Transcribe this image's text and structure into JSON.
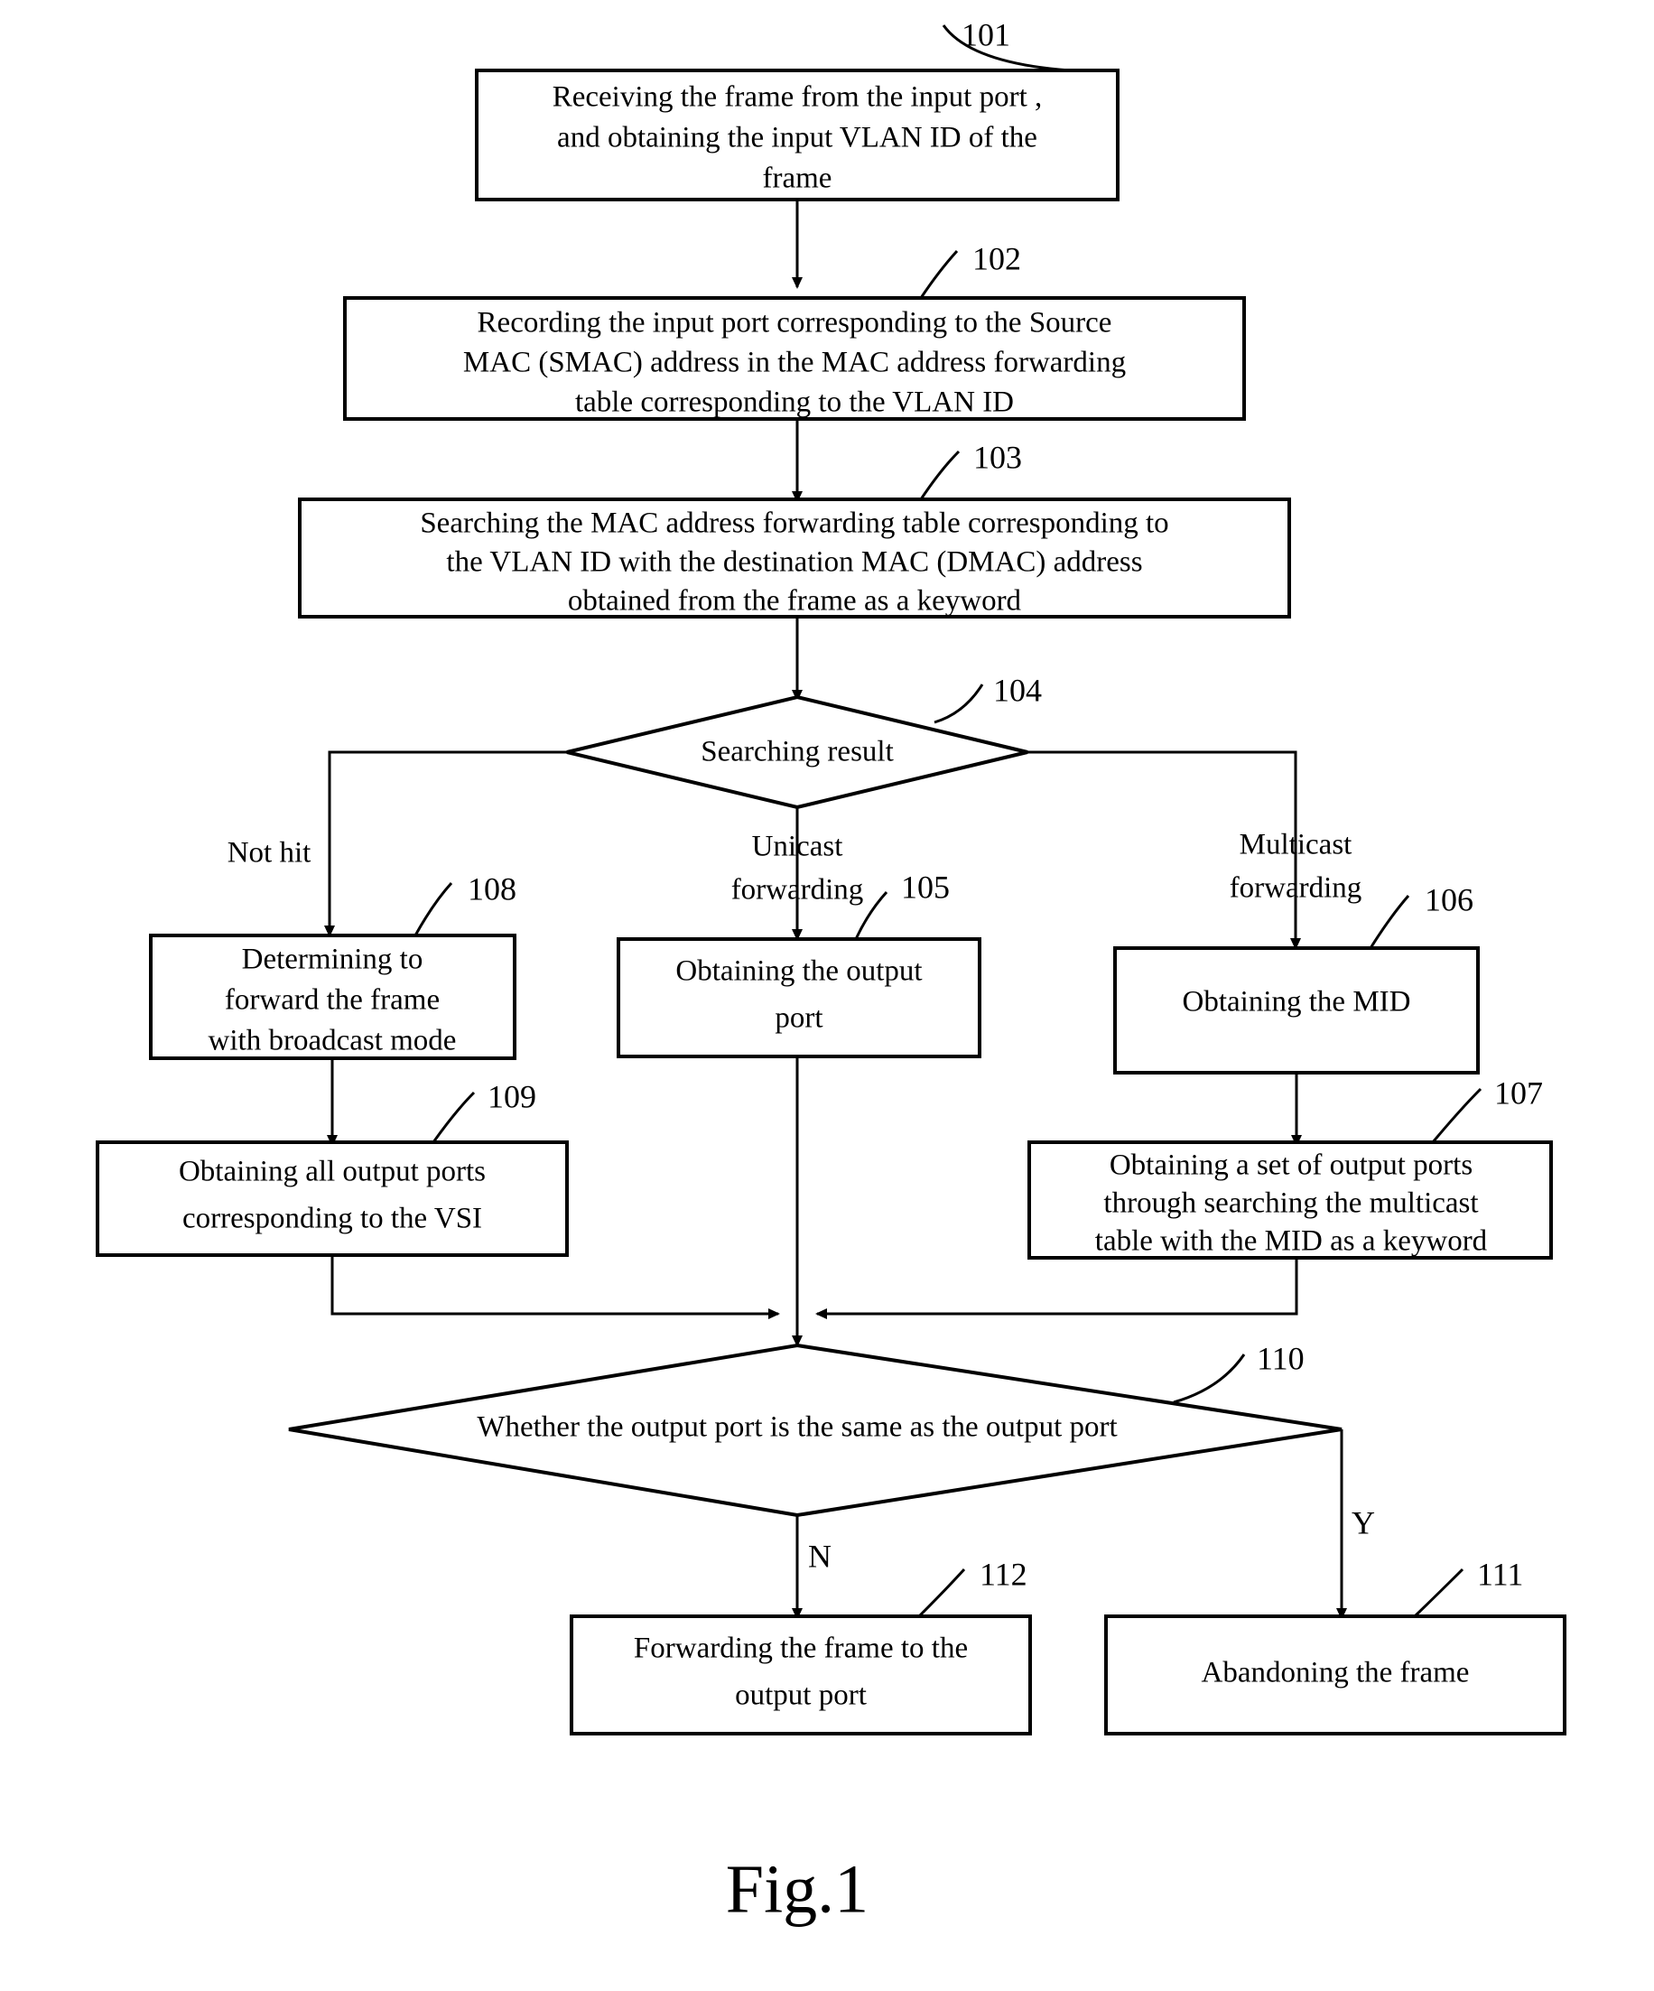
{
  "figure": {
    "caption": "Fig.1",
    "type": "flowchart"
  },
  "nodes": [
    {
      "id": "101",
      "ref": "101",
      "shape": "rect",
      "lines": [
        "Receiving the frame from the input port ,",
        "and obtaining the input VLAN ID of the",
        "frame"
      ],
      "name": "node-101-receive-frame"
    },
    {
      "id": "102",
      "ref": "102",
      "shape": "rect",
      "lines": [
        "Recording the input port corresponding to the Source",
        "MAC (SMAC) address in the MAC address forwarding",
        "table corresponding to the VLAN ID"
      ],
      "name": "node-102-record-input-port"
    },
    {
      "id": "103",
      "ref": "103",
      "shape": "rect",
      "lines": [
        "Searching the MAC address forwarding table corresponding to",
        "the VLAN ID with the destination MAC (DMAC) address",
        "obtained from the frame  as a keyword"
      ],
      "name": "node-103-search-table"
    },
    {
      "id": "104",
      "ref": "104",
      "shape": "diamond",
      "lines": [
        "Searching result"
      ],
      "name": "node-104-searching-result"
    },
    {
      "id": "108",
      "ref": "108",
      "shape": "rect",
      "lines": [
        "Determining to",
        "forward the frame",
        "with broadcast mode"
      ],
      "name": "node-108-broadcast-mode"
    },
    {
      "id": "105",
      "ref": "105",
      "shape": "rect",
      "lines": [
        "Obtaining the output",
        "port"
      ],
      "name": "node-105-obtain-output-port"
    },
    {
      "id": "106",
      "ref": "106",
      "shape": "rect",
      "lines": [
        "Obtaining the MID"
      ],
      "name": "node-106-obtain-mid"
    },
    {
      "id": "109",
      "ref": "109",
      "shape": "rect",
      "lines": [
        "Obtaining all output ports",
        "corresponding to the VSI"
      ],
      "name": "node-109-all-output-ports"
    },
    {
      "id": "107",
      "ref": "107",
      "shape": "rect",
      "lines": [
        "Obtaining a set of output ports",
        "through searching the multicast",
        "table with the MID as a keyword"
      ],
      "name": "node-107-set-of-output-ports"
    },
    {
      "id": "110",
      "ref": "110",
      "shape": "diamond",
      "lines": [
        "Whether the output port is the same as the output port"
      ],
      "name": "node-110-same-output-port"
    },
    {
      "id": "112",
      "ref": "112",
      "shape": "rect",
      "lines": [
        "Forwarding the frame to the",
        "output port"
      ],
      "name": "node-112-forward-frame"
    },
    {
      "id": "111",
      "ref": "111",
      "shape": "rect",
      "lines": [
        "Abandoning the frame"
      ],
      "name": "node-111-abandon-frame"
    }
  ],
  "edge_labels": {
    "not_hit": [
      "Not hit"
    ],
    "unicast": [
      "Unicast",
      "forwarding"
    ],
    "multicast": [
      "Multicast",
      "forwarding"
    ],
    "no": "N",
    "yes": "Y"
  },
  "colors": {
    "stroke": "#000000",
    "fill": "#ffffff",
    "text": "#000000"
  }
}
